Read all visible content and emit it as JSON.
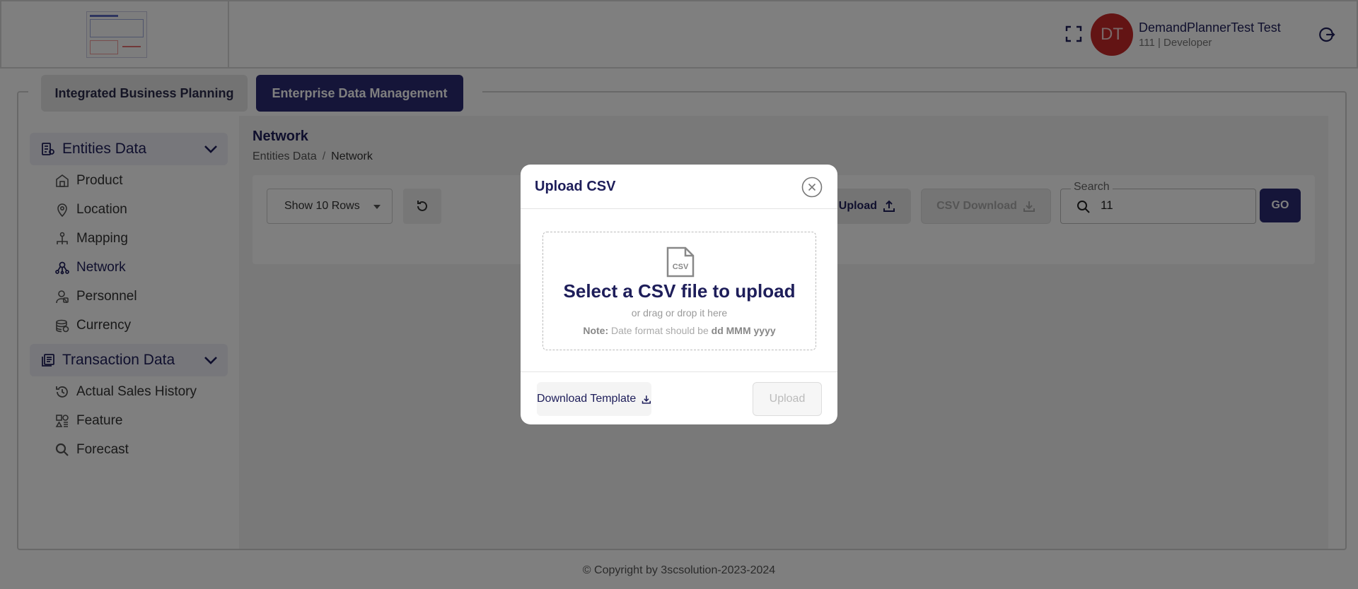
{
  "user": {
    "initials": "DT",
    "name": "DemandPlannerTest Test",
    "role": "111 | Developer"
  },
  "tabs": [
    {
      "label": "Integrated Business Planning"
    },
    {
      "label": "Enterprise Data Management"
    }
  ],
  "sidebar": {
    "groups": [
      {
        "label": "Entities Data",
        "items": [
          {
            "label": "Product"
          },
          {
            "label": "Location"
          },
          {
            "label": "Mapping"
          },
          {
            "label": "Network"
          },
          {
            "label": "Personnel"
          },
          {
            "label": "Currency"
          }
        ]
      },
      {
        "label": "Transaction Data",
        "items": [
          {
            "label": "Actual Sales History"
          },
          {
            "label": "Feature"
          },
          {
            "label": "Forecast"
          }
        ]
      }
    ]
  },
  "main": {
    "title": "Network",
    "breadcrumb": {
      "parent": "Entities Data",
      "separator": "/",
      "current": "Network"
    },
    "toolbar": {
      "rows_select": "Show 10 Rows",
      "upload_label": "Upload",
      "csv_download_label": "CSV Download",
      "search_label": "Search",
      "search_value": "11",
      "go_label": "GO"
    }
  },
  "modal": {
    "title": "Upload CSV",
    "dropzone_icon_text": "CSV",
    "dropzone_title": "Select a CSV file to upload",
    "dropzone_sub": "or drag or drop it here",
    "note_label": "Note:",
    "note_text": "Date format should be",
    "note_format": "dd MMM yyyy",
    "download_template_label": "Download Template",
    "upload_label": "Upload"
  },
  "footer": {
    "copyright": "© Copyright by 3scsolution-2023-2024"
  },
  "colors": {
    "primary": "#2b2a72",
    "avatar": "#c62828",
    "text_dark": "#1e1e5a"
  }
}
